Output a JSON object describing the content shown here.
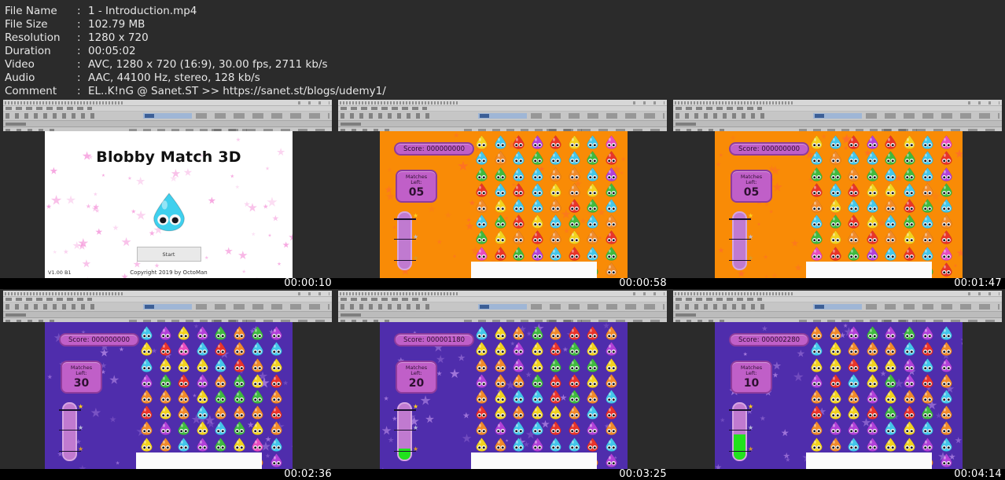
{
  "metadata": {
    "rows": [
      {
        "key": "File Name",
        "sep": ":",
        "value": "1 - Introduction.mp4"
      },
      {
        "key": "File Size",
        "sep": ":",
        "value": "102.79 MB"
      },
      {
        "key": "Resolution",
        "sep": ":",
        "value": "1280 x 720"
      },
      {
        "key": "Duration",
        "sep": ":",
        "value": "00:05:02"
      },
      {
        "key": "Video",
        "sep": ":",
        "value": "AVC, 1280 x 720 (16:9), 30.00 fps, 2711 kb/s"
      },
      {
        "key": "Audio",
        "sep": ":",
        "value": "AAC, 44100 Hz, stereo, 128 kb/s"
      },
      {
        "key": "Comment",
        "sep": ":",
        "value": "EL..K!nG @ Sanet.ST >> https://sanet.st/blogs/udemy1/"
      }
    ]
  },
  "colors": {
    "page_background": "#2b2b2b",
    "orange_level": "#f98b06",
    "purple_level": "#4f2dac",
    "hud_panel": "#c05fc8",
    "hud_border": "#8e3b9c",
    "bar_tube": "#c07ad0",
    "bar_fill_green": "#21e21d",
    "timestamp_band": "#000000",
    "menu_background": "#ffffff"
  },
  "menu_screen": {
    "title": "Blobby Match 3D",
    "start_label": "Start",
    "version": "V1.00 B1",
    "copyright": "Copyright 2019 by OctoMan"
  },
  "hud_labels": {
    "score_prefix": "Score: ",
    "matches_line1": "Matches",
    "matches_line2": "Left:"
  },
  "thumbnails": [
    {
      "index": 1,
      "timestamp": "00:00:10",
      "scene": "menu",
      "background": "#ffffff",
      "score": null,
      "matches_left": null,
      "bar_fill_percent": 0
    },
    {
      "index": 2,
      "timestamp": "00:00:58",
      "scene": "level",
      "background": "#f98b06",
      "score": "000000000",
      "matches_left": "05",
      "bar_fill_percent": 0
    },
    {
      "index": 3,
      "timestamp": "00:01:47",
      "scene": "level",
      "background": "#f98b06",
      "score": "000000000",
      "matches_left": "05",
      "bar_fill_percent": 0
    },
    {
      "index": 4,
      "timestamp": "00:02:36",
      "scene": "level",
      "background": "#4f2dac",
      "score": "000000000",
      "matches_left": "30",
      "bar_fill_percent": 0
    },
    {
      "index": 5,
      "timestamp": "00:03:25",
      "scene": "level",
      "background": "#4f2dac",
      "score": "000001180",
      "matches_left": "20",
      "bar_fill_percent": 20
    },
    {
      "index": 6,
      "timestamp": "00:04:14",
      "scene": "level",
      "background": "#4f2dac",
      "score": "000002280",
      "matches_left": "10",
      "bar_fill_percent": 45
    }
  ],
  "progress_bar": {
    "stars": [
      {
        "name": "gold-star",
        "glyph": "★",
        "color": "#ffcf1b",
        "top_percent": 2
      },
      {
        "name": "silver-star",
        "glyph": "★",
        "color": "#b9bcd6",
        "top_percent": 38
      },
      {
        "name": "bronze-star",
        "glyph": "★",
        "color": "#d79a2b",
        "top_percent": 74
      }
    ],
    "tick_top_percents": [
      12,
      46,
      82
    ]
  },
  "blob_palette": [
    "#f2d21e",
    "#43c6ea",
    "#e8342a",
    "#b240d8",
    "#f08a2a",
    "#3fb93f",
    "#e84cc0",
    "#f2a6c6"
  ],
  "blob_grids": {
    "t2": [
      [
        0,
        1,
        2,
        3,
        2,
        0,
        1,
        6
      ],
      [
        1,
        4,
        1,
        5,
        1,
        1,
        5,
        2
      ],
      [
        5,
        5,
        1,
        1,
        4,
        4,
        1,
        3
      ],
      [
        2,
        1,
        2,
        1,
        0,
        4,
        0,
        5
      ],
      [
        4,
        0,
        1,
        1,
        4,
        2,
        5,
        1
      ],
      [
        1,
        5,
        2,
        0,
        1,
        5,
        1,
        4
      ],
      [
        5,
        0,
        4,
        2,
        4,
        0,
        4,
        2
      ],
      [
        6,
        2,
        5,
        3,
        1,
        2,
        1,
        5
      ],
      [
        1,
        5,
        2,
        1,
        0,
        3,
        5,
        4
      ]
    ],
    "t3": [
      [
        0,
        1,
        2,
        3,
        2,
        0,
        1,
        6
      ],
      [
        1,
        4,
        1,
        1,
        5,
        5,
        1,
        2
      ],
      [
        5,
        5,
        4,
        5,
        1,
        5,
        1,
        3
      ],
      [
        2,
        1,
        2,
        0,
        0,
        1,
        4,
        5
      ],
      [
        4,
        0,
        1,
        1,
        4,
        2,
        5,
        1
      ],
      [
        1,
        5,
        2,
        0,
        1,
        5,
        1,
        4
      ],
      [
        5,
        0,
        4,
        2,
        4,
        0,
        4,
        2
      ],
      [
        6,
        2,
        5,
        3,
        1,
        2,
        1,
        6
      ],
      [
        1,
        5,
        2,
        1,
        0,
        6,
        5,
        2
      ]
    ],
    "t4": [
      [
        1,
        3,
        0,
        3,
        5,
        4,
        5,
        3
      ],
      [
        0,
        2,
        6,
        1,
        2,
        4,
        1,
        1
      ],
      [
        1,
        0,
        0,
        0,
        1,
        2,
        4,
        0
      ],
      [
        3,
        5,
        2,
        3,
        4,
        5,
        0,
        2
      ],
      [
        4,
        4,
        4,
        0,
        5,
        5,
        5,
        4
      ],
      [
        2,
        0,
        4,
        1,
        4,
        4,
        4,
        2
      ],
      [
        4,
        3,
        5,
        0,
        1,
        5,
        0,
        4
      ],
      [
        0,
        4,
        1,
        3,
        5,
        0,
        6,
        1
      ],
      [
        5,
        3,
        1,
        2,
        4,
        2,
        4,
        3
      ]
    ],
    "t5": [
      [
        1,
        0,
        4,
        5,
        4,
        2,
        2,
        4
      ],
      [
        0,
        0,
        3,
        0,
        2,
        5,
        0,
        3
      ],
      [
        4,
        4,
        3,
        0,
        5,
        5,
        5,
        0
      ],
      [
        3,
        4,
        4,
        5,
        2,
        2,
        0,
        4
      ],
      [
        4,
        0,
        1,
        1,
        2,
        5,
        4,
        1
      ],
      [
        2,
        0,
        4,
        0,
        0,
        4,
        1,
        2
      ],
      [
        4,
        3,
        1,
        1,
        2,
        2,
        3,
        4
      ],
      [
        0,
        4,
        1,
        3,
        1,
        1,
        2,
        1
      ],
      [
        5,
        3,
        5,
        2,
        4,
        2,
        4,
        3
      ]
    ],
    "t6": [
      [
        4,
        4,
        3,
        5,
        3,
        5,
        3,
        1
      ],
      [
        1,
        0,
        4,
        4,
        4,
        1,
        2,
        4
      ],
      [
        0,
        0,
        2,
        0,
        0,
        3,
        1,
        3
      ],
      [
        3,
        2,
        1,
        0,
        5,
        3,
        2,
        4
      ],
      [
        4,
        0,
        4,
        3,
        0,
        4,
        4,
        1
      ],
      [
        2,
        0,
        0,
        2,
        5,
        2,
        5,
        4
      ],
      [
        4,
        3,
        3,
        3,
        1,
        0,
        1,
        4
      ],
      [
        0,
        4,
        1,
        3,
        0,
        0,
        3,
        1
      ],
      [
        5,
        4,
        3,
        2,
        4,
        2,
        4,
        3
      ]
    ]
  }
}
